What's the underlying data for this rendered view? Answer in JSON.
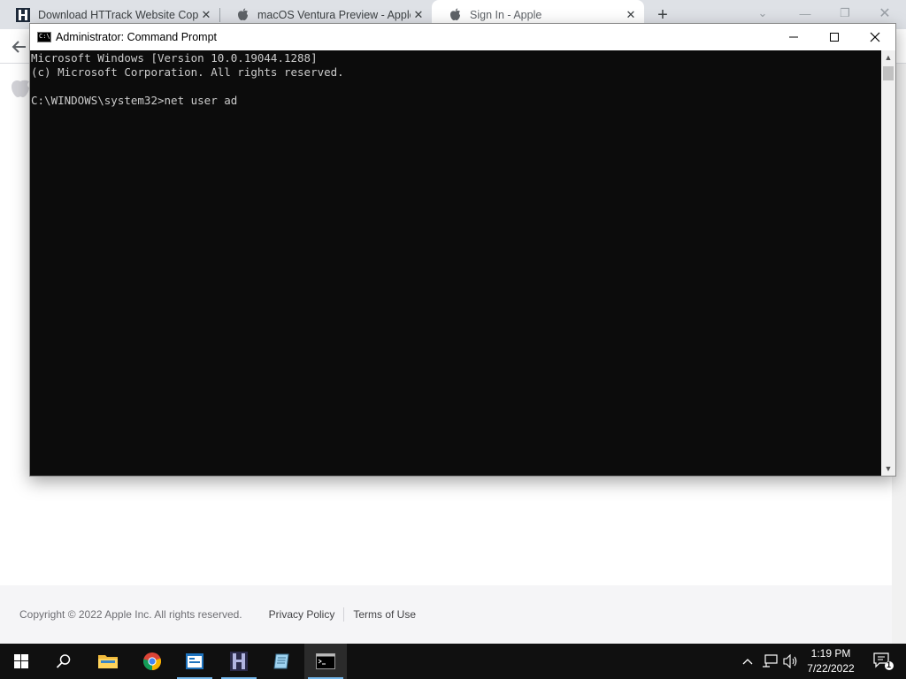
{
  "browser": {
    "tabs": [
      {
        "title": "Download HTTrack Website Copi",
        "favicon": "httrack-icon"
      },
      {
        "title": "macOS Ventura Preview - Apple",
        "favicon": "apple-icon"
      },
      {
        "title": "Sign In - Apple",
        "favicon": "apple-icon",
        "active": true
      }
    ],
    "new_tab_symbol": "+"
  },
  "cmd": {
    "title": "Administrator: Command Prompt",
    "icon_text": "C:\\",
    "lines": [
      "Microsoft Windows [Version 10.0.19044.1288]",
      "(c) Microsoft Corporation. All rights reserved.",
      "",
      "C:\\WINDOWS\\system32>net user ad"
    ]
  },
  "footer": {
    "copyright": "Copyright © 2022 Apple Inc. All rights reserved.",
    "privacy": "Privacy Policy",
    "terms": "Terms of Use"
  },
  "taskbar": {
    "apps": [
      "start-icon",
      "search-icon",
      "file-explorer-icon",
      "chrome-icon",
      "app-icon",
      "httrack-icon",
      "notepad-icon",
      "cmd-icon"
    ],
    "time": "1:19 PM",
    "date": "7/22/2022",
    "notification_count": "1"
  },
  "colors": {
    "console_bg": "#0c0c0c",
    "console_text": "#cccccc",
    "taskbar_bg": "#101010"
  }
}
